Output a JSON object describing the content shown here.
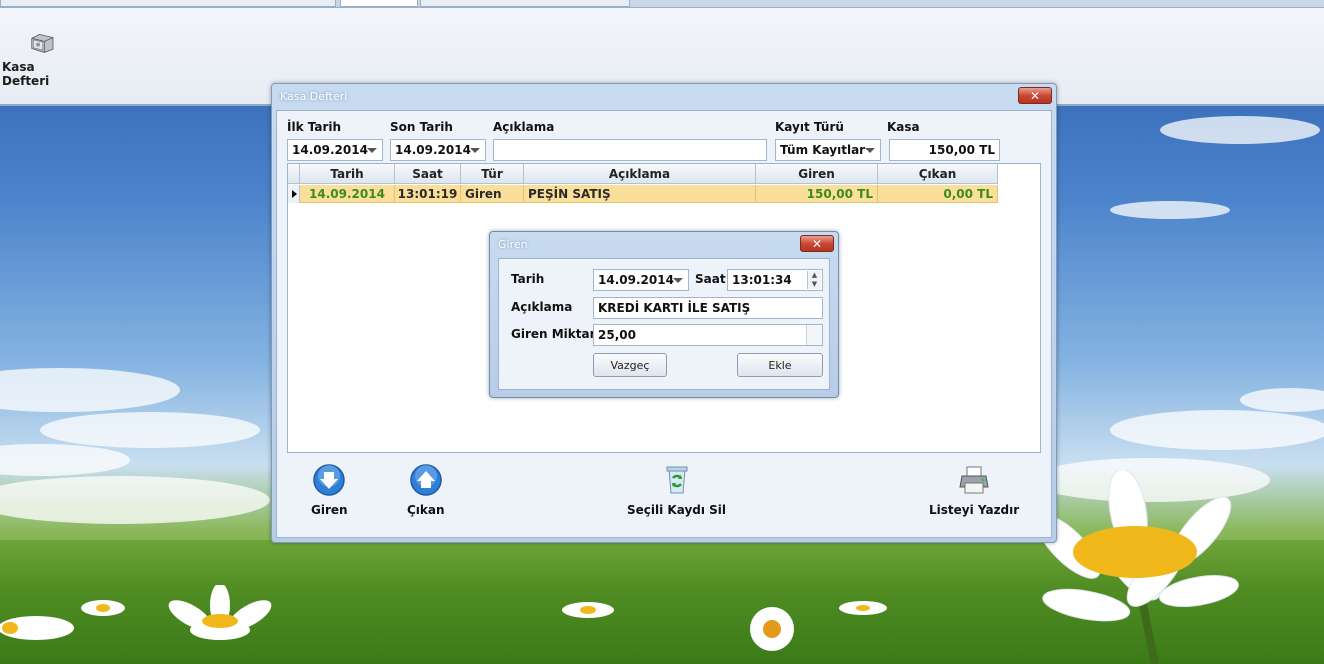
{
  "ribbon": {
    "kasa_defteri_label": "Kasa Defteri"
  },
  "main_window": {
    "title": "Kasa Defteri",
    "filters": {
      "ilk_tarih_label": "İlk Tarih",
      "ilk_tarih_value": "14.09.2014",
      "son_tarih_label": "Son Tarih",
      "son_tarih_value": "14.09.2014",
      "aciklama_label": "Açıklama",
      "aciklama_value": "",
      "kayit_turu_label": "Kayıt Türü",
      "kayit_turu_value": "Tüm Kayıtlar",
      "kasa_label": "Kasa",
      "kasa_value": "150,00 TL"
    },
    "table": {
      "columns": [
        "Tarih",
        "Saat",
        "Tür",
        "Açıklama",
        "Giren",
        "Çıkan"
      ],
      "rows": [
        {
          "tarih": "14.09.2014",
          "saat": "13:01:19",
          "tur": "Giren",
          "aciklama": "PEŞİN SATIŞ",
          "giren": "150,00 TL",
          "cikan": "0,00 TL"
        }
      ]
    },
    "buttons": {
      "giren": "Giren",
      "cikan": "Çıkan",
      "secili_kaydi_sil": "Seçili Kaydı Sil",
      "listeyi_yazdir": "Listeyi Yazdır"
    },
    "colors": {
      "selected_row": "#f9df9a",
      "row_text": "#3d8c1b"
    }
  },
  "dialog": {
    "title": "Giren",
    "tarih_label": "Tarih",
    "tarih_value": "14.09.2014",
    "saat_label": "Saat",
    "saat_value": "13:01:34",
    "aciklama_label": "Açıklama",
    "aciklama_value": "KREDİ KARTI İLE SATIŞ",
    "miktar_label": "Giren Miktar",
    "miktar_value": "25,00",
    "vazgec_label": "Vazgeç",
    "ekle_label": "Ekle"
  },
  "icons": [
    "safe-icon",
    "close-icon",
    "arrow-down-icon",
    "arrow-up-icon",
    "recycle-bin-icon",
    "printer-icon",
    "chevron-down-icon",
    "spinner-icon"
  ]
}
